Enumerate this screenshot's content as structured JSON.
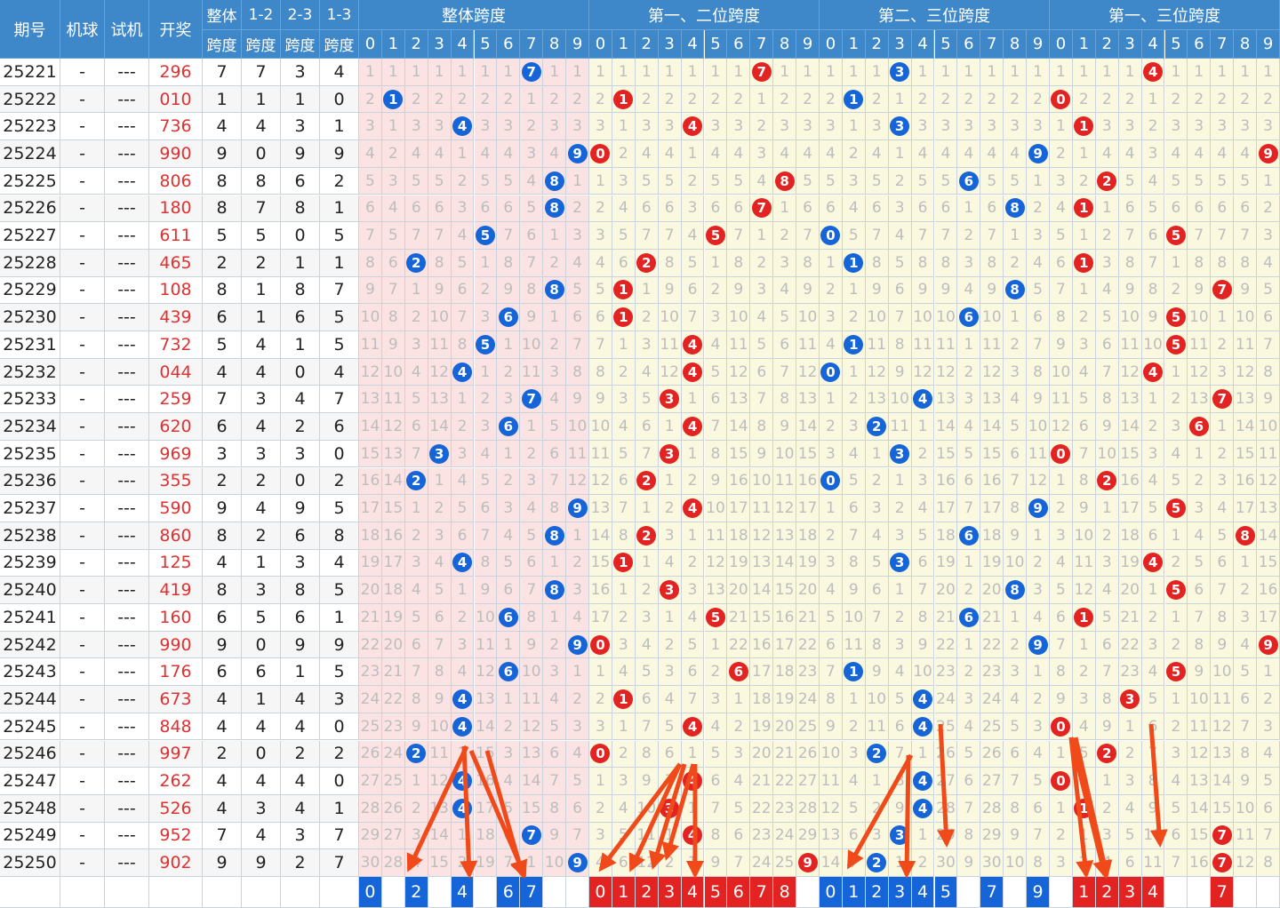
{
  "header": {
    "period": "期号",
    "machine": "机球",
    "trial": "试机",
    "draw": "开奖",
    "span_total": [
      "整体",
      "跨度"
    ],
    "span_12": [
      "1-2",
      "跨度"
    ],
    "span_23": [
      "2-3",
      "跨度"
    ],
    "span_13": [
      "1-3",
      "跨度"
    ],
    "groups": [
      "整体跨度",
      "第一、二位跨度",
      "第二、三位跨度",
      "第一、三位跨度"
    ],
    "digits": [
      "0",
      "1",
      "2",
      "3",
      "4",
      "5",
      "6",
      "7",
      "8",
      "9"
    ]
  },
  "colors": {
    "header_bg": "#3e87c8",
    "blue_ball": "#1565d8",
    "red_ball": "#e32222",
    "draw_text": "#e03131",
    "arrow": "#f04a1a"
  },
  "rows": [
    {
      "period": "25221",
      "machine": "-",
      "trial": "---",
      "draw": "296",
      "st": "7",
      "s12": "7",
      "s23": "3",
      "s13": "4"
    },
    {
      "period": "25222",
      "machine": "-",
      "trial": "---",
      "draw": "010",
      "st": "1",
      "s12": "1",
      "s23": "1",
      "s13": "0"
    },
    {
      "period": "25223",
      "machine": "-",
      "trial": "---",
      "draw": "736",
      "st": "4",
      "s12": "4",
      "s23": "3",
      "s13": "1"
    },
    {
      "period": "25224",
      "machine": "-",
      "trial": "---",
      "draw": "990",
      "st": "9",
      "s12": "0",
      "s23": "9",
      "s13": "9"
    },
    {
      "period": "25225",
      "machine": "-",
      "trial": "---",
      "draw": "806",
      "st": "8",
      "s12": "8",
      "s23": "6",
      "s13": "2"
    },
    {
      "period": "25226",
      "machine": "-",
      "trial": "---",
      "draw": "180",
      "st": "8",
      "s12": "7",
      "s23": "8",
      "s13": "1"
    },
    {
      "period": "25227",
      "machine": "-",
      "trial": "---",
      "draw": "611",
      "st": "5",
      "s12": "5",
      "s23": "0",
      "s13": "5"
    },
    {
      "period": "25228",
      "machine": "-",
      "trial": "---",
      "draw": "465",
      "st": "2",
      "s12": "2",
      "s23": "1",
      "s13": "1"
    },
    {
      "period": "25229",
      "machine": "-",
      "trial": "---",
      "draw": "108",
      "st": "8",
      "s12": "1",
      "s23": "8",
      "s13": "7"
    },
    {
      "period": "25230",
      "machine": "-",
      "trial": "---",
      "draw": "439",
      "st": "6",
      "s12": "1",
      "s23": "6",
      "s13": "5"
    },
    {
      "period": "25231",
      "machine": "-",
      "trial": "---",
      "draw": "732",
      "st": "5",
      "s12": "4",
      "s23": "1",
      "s13": "5"
    },
    {
      "period": "25232",
      "machine": "-",
      "trial": "---",
      "draw": "044",
      "st": "4",
      "s12": "4",
      "s23": "0",
      "s13": "4"
    },
    {
      "period": "25233",
      "machine": "-",
      "trial": "---",
      "draw": "259",
      "st": "7",
      "s12": "3",
      "s23": "4",
      "s13": "7"
    },
    {
      "period": "25234",
      "machine": "-",
      "trial": "---",
      "draw": "620",
      "st": "6",
      "s12": "4",
      "s23": "2",
      "s13": "6"
    },
    {
      "period": "25235",
      "machine": "-",
      "trial": "---",
      "draw": "969",
      "st": "3",
      "s12": "3",
      "s23": "3",
      "s13": "0"
    },
    {
      "period": "25236",
      "machine": "-",
      "trial": "---",
      "draw": "355",
      "st": "2",
      "s12": "2",
      "s23": "0",
      "s13": "2"
    },
    {
      "period": "25237",
      "machine": "-",
      "trial": "---",
      "draw": "590",
      "st": "9",
      "s12": "4",
      "s23": "9",
      "s13": "5"
    },
    {
      "period": "25238",
      "machine": "-",
      "trial": "---",
      "draw": "860",
      "st": "8",
      "s12": "2",
      "s23": "6",
      "s13": "8"
    },
    {
      "period": "25239",
      "machine": "-",
      "trial": "---",
      "draw": "125",
      "st": "4",
      "s12": "1",
      "s23": "3",
      "s13": "4"
    },
    {
      "period": "25240",
      "machine": "-",
      "trial": "---",
      "draw": "419",
      "st": "8",
      "s12": "3",
      "s23": "8",
      "s13": "5"
    },
    {
      "period": "25241",
      "machine": "-",
      "trial": "---",
      "draw": "160",
      "st": "6",
      "s12": "5",
      "s23": "6",
      "s13": "1"
    },
    {
      "period": "25242",
      "machine": "-",
      "trial": "---",
      "draw": "990",
      "st": "9",
      "s12": "0",
      "s23": "9",
      "s13": "9"
    },
    {
      "period": "25243",
      "machine": "-",
      "trial": "---",
      "draw": "176",
      "st": "6",
      "s12": "6",
      "s23": "1",
      "s13": "5"
    },
    {
      "period": "25244",
      "machine": "-",
      "trial": "---",
      "draw": "673",
      "st": "4",
      "s12": "1",
      "s23": "4",
      "s13": "3"
    },
    {
      "period": "25245",
      "machine": "-",
      "trial": "---",
      "draw": "848",
      "st": "4",
      "s12": "4",
      "s23": "4",
      "s13": "0"
    },
    {
      "period": "25246",
      "machine": "-",
      "trial": "---",
      "draw": "997",
      "st": "2",
      "s12": "0",
      "s23": "2",
      "s13": "2"
    },
    {
      "period": "25247",
      "machine": "-",
      "trial": "---",
      "draw": "262",
      "st": "4",
      "s12": "4",
      "s23": "4",
      "s13": "0"
    },
    {
      "period": "25248",
      "machine": "-",
      "trial": "---",
      "draw": "526",
      "st": "4",
      "s12": "3",
      "s23": "4",
      "s13": "1"
    },
    {
      "period": "25249",
      "machine": "-",
      "trial": "---",
      "draw": "952",
      "st": "7",
      "s12": "4",
      "s23": "3",
      "s13": "7"
    },
    {
      "period": "25250",
      "machine": "-",
      "trial": "---",
      "draw": "902",
      "st": "9",
      "s12": "9",
      "s23": "2",
      "s13": "7"
    }
  ],
  "summary": [
    [
      "0",
      "",
      "2",
      "",
      "4",
      "",
      "6",
      "7",
      "",
      ""
    ],
    [
      "0",
      "1",
      "2",
      "3",
      "4",
      "5",
      "6",
      "7",
      "8",
      ""
    ],
    [
      "0",
      "1",
      "2",
      "3",
      "4",
      "5",
      "",
      "7",
      "",
      "9"
    ],
    [
      "",
      "1",
      "2",
      "3",
      "4",
      "",
      "",
      "7",
      "",
      ""
    ]
  ]
}
